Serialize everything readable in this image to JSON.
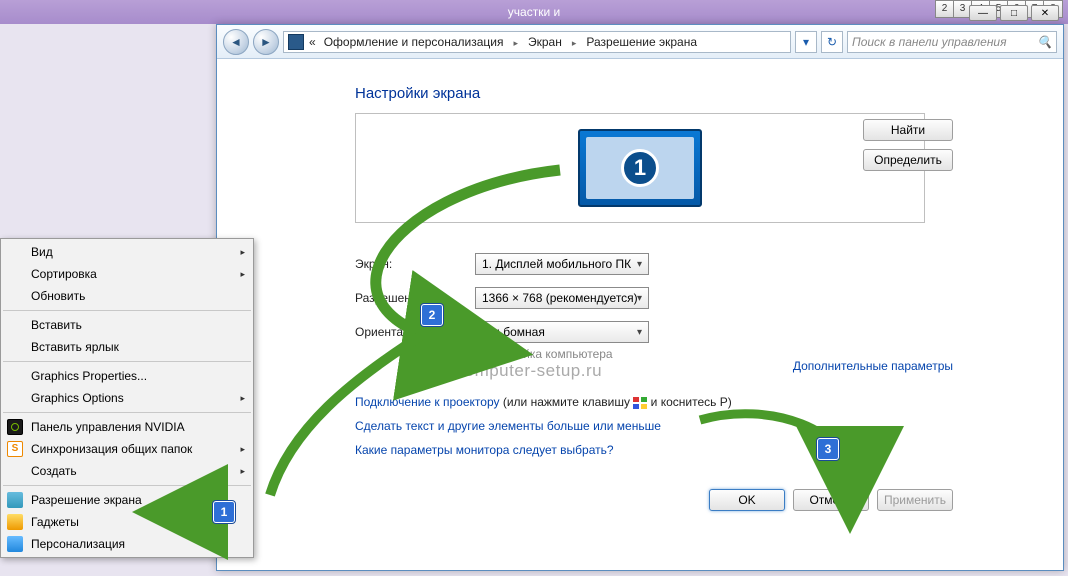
{
  "topbar_title": "участки и",
  "pager": [
    "2",
    "3",
    "4",
    "5",
    "6",
    "7",
    "8"
  ],
  "win_ctrl": {
    "min": "—",
    "max": "□",
    "close": "✕"
  },
  "breadcrumb": {
    "prefix": "«",
    "items": [
      "Оформление и персонализация",
      "Экран",
      "Разрешение экрана"
    ]
  },
  "search_placeholder": "Поиск в панели управления",
  "heading": "Настройки экрана",
  "monitor_number": "1",
  "buttons": {
    "find": "Найти",
    "detect": "Определить"
  },
  "rows": {
    "display_label": "Экран:",
    "display_value": "1. Дисплей мобильного ПК",
    "resolution_label": "Разрешение:",
    "resolution_value": "1366 × 768 (рекомендуется)",
    "orientation_label": "Ориентация:",
    "orientation_value": "Альбомная"
  },
  "hint": "Настройка компьютера",
  "watermark": "www.computer-setup.ru",
  "advanced": "Дополнительные параметры",
  "projector_link": "Подключение к проектору",
  "projector_tail_a": " (или нажмите клавишу ",
  "projector_tail_b": " и коснитесь P)",
  "bigger_link": "Сделать текст и другие элементы больше или меньше",
  "which_link": "Какие параметры монитора следует выбрать?",
  "actions": {
    "ok": "OK",
    "cancel": "Отмена",
    "apply": "Применить"
  },
  "ctx": {
    "view": "Вид",
    "sort": "Сортировка",
    "refresh": "Обновить",
    "paste": "Вставить",
    "paste_shortcut": "Вставить ярлык",
    "gprops": "Graphics Properties...",
    "gopts": "Graphics Options",
    "nvidia": "Панель управления NVIDIA",
    "sync": "Синхронизация общих папок",
    "create": "Создать",
    "screenres": "Разрешение экрана",
    "gadgets": "Гаджеты",
    "personalize": "Персонализация"
  },
  "callouts": {
    "c1": "1",
    "c2": "2",
    "c3": "3"
  }
}
